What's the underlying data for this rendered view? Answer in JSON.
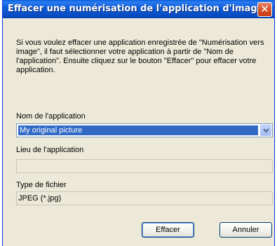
{
  "window": {
    "title": "Effacer une numérisation de l'application d'image"
  },
  "close_glyph": "✕",
  "description": "Si vous voulez effacer une application enregistrée de \"Numérisation vers image\", il faut sélectionner votre application à partir de \"Nom de l'application\". Ensuite cliquez sur le bouton \"Effacer\" pour effacer votre application.",
  "fields": {
    "app_name": {
      "label": "Nom de l'application",
      "value": "My original picture"
    },
    "app_location": {
      "label": "Lieu de l'application",
      "value": ""
    },
    "file_type": {
      "label": "Type de fichier",
      "value": "JPEG (*.jpg)"
    }
  },
  "buttons": {
    "delete": "Effacer",
    "cancel": "Annuler"
  },
  "colors": {
    "titlebar": "#0a5fd8",
    "selection": "#316ac5",
    "dialog_bg": "#ece9d8"
  }
}
